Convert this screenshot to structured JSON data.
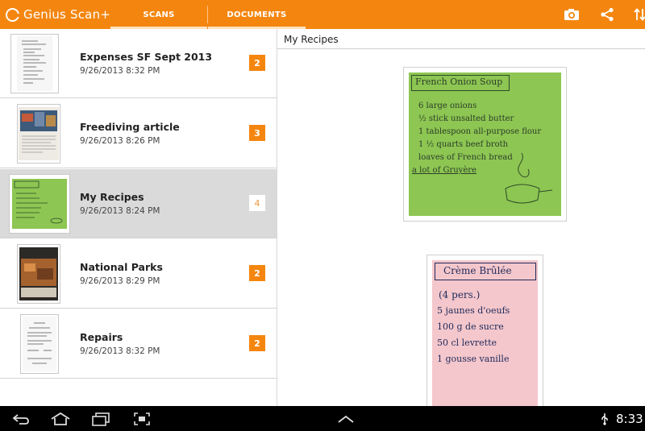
{
  "app": {
    "title": "Genius Scan+"
  },
  "tabs": [
    {
      "label": "SCANS",
      "selected": false
    },
    {
      "label": "DOCUMENTS",
      "selected": true
    }
  ],
  "actions": {
    "camera": "camera-icon",
    "share": "share-icon",
    "sort": "sort-icon"
  },
  "documents": [
    {
      "title": "Expenses SF Sept 2013",
      "date": "9/26/2013 8:32 PM",
      "count": "2",
      "selected": false
    },
    {
      "title": "Freediving article",
      "date": "9/26/2013 8:26 PM",
      "count": "3",
      "selected": false
    },
    {
      "title": "My Recipes",
      "date": "9/26/2013 8:24 PM",
      "count": "4",
      "selected": true
    },
    {
      "title": "National Parks",
      "date": "9/26/2013 8:29 PM",
      "count": "2",
      "selected": false
    },
    {
      "title": "Repairs",
      "date": "9/26/2013 8:32 PM",
      "count": "2",
      "selected": false
    }
  ],
  "viewer": {
    "title": "My Recipes",
    "page1": {
      "heading": "French Onion Soup",
      "lines": [
        "6 large onions",
        "½ stick unsalted butter",
        "1 tablespoon all-purpose flour",
        "1 ½ quarts beef broth",
        "loaves of French bread",
        "a lot of Gruyère"
      ]
    },
    "page2": {
      "heading": "Crème Brûlée",
      "lines": [
        "(4 pers.)",
        "5 jaunes d'oeufs",
        "100 g de sucre",
        "50 cl levrette",
        "1 gousse vanille"
      ]
    }
  },
  "statusbar": {
    "time": "8:33"
  },
  "colors": {
    "accent": "#f4860f",
    "selected_row": "#dadada",
    "note_green": "#8dc652",
    "note_pink": "#f4c7cc"
  }
}
